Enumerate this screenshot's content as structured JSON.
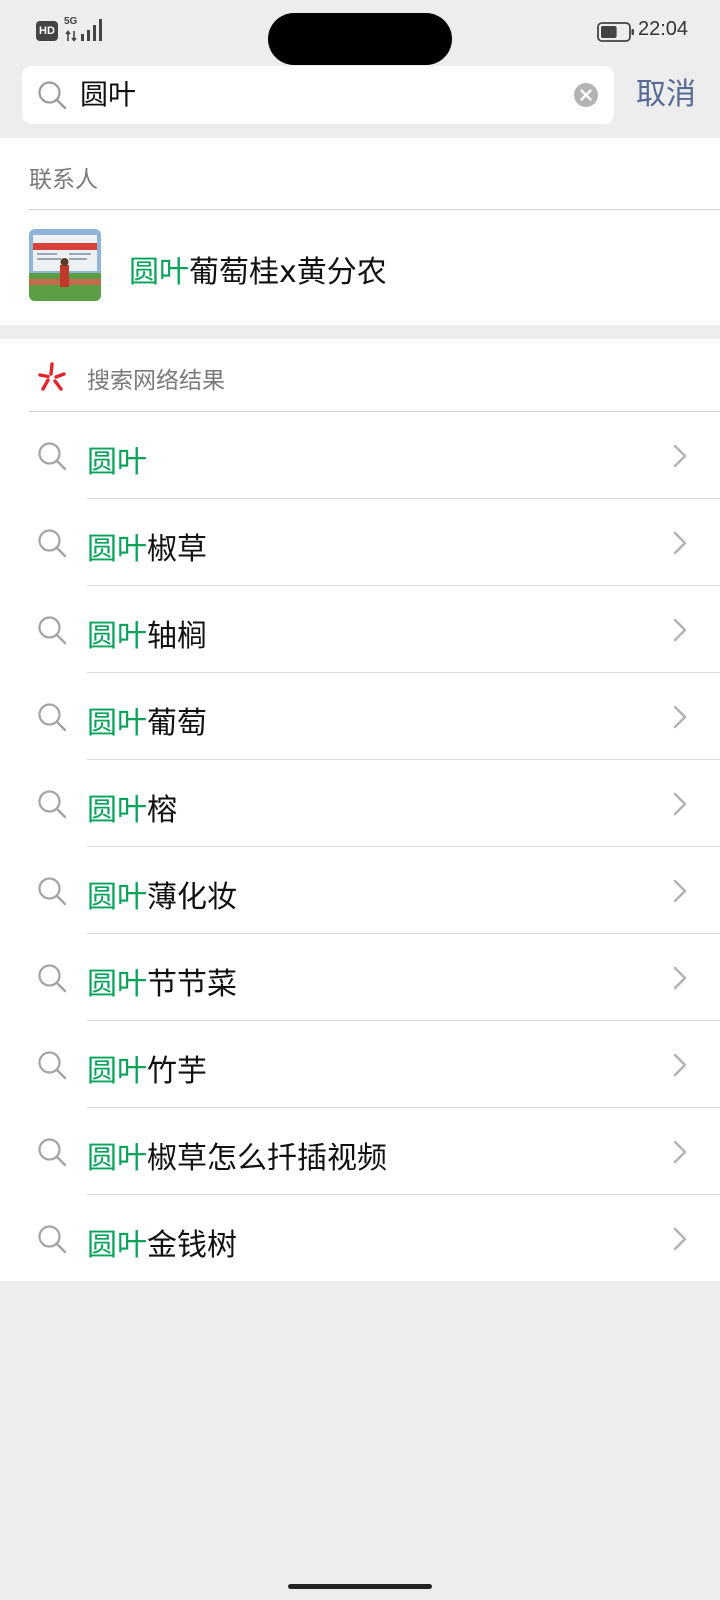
{
  "status_bar": {
    "hd_label": "HD",
    "network_label": "5G",
    "time": "22:04",
    "battery_level": 0.6
  },
  "search": {
    "query": "圆叶",
    "cancel_label": "取消"
  },
  "contacts": {
    "section_title": "联系人",
    "items": [
      {
        "highlight": "圆叶",
        "rest": "葡萄桂x黄分农"
      }
    ]
  },
  "web_results": {
    "section_title": "搜索网络结果",
    "items": [
      {
        "highlight": "圆叶",
        "rest": ""
      },
      {
        "highlight": "圆叶",
        "rest": "椒草"
      },
      {
        "highlight": "圆叶",
        "rest": "轴榈"
      },
      {
        "highlight": "圆叶",
        "rest": "葡萄"
      },
      {
        "highlight": "圆叶",
        "rest": "榕"
      },
      {
        "highlight": "圆叶",
        "rest": "薄化妆"
      },
      {
        "highlight": "圆叶",
        "rest": "节节菜"
      },
      {
        "highlight": "圆叶",
        "rest": "竹芋"
      },
      {
        "highlight": "圆叶",
        "rest": "椒草怎么扦插视频"
      },
      {
        "highlight": "圆叶",
        "rest": "金钱树"
      }
    ]
  },
  "colors": {
    "highlight": "#07a35a",
    "cancel": "#576b95",
    "background": "#ededed"
  },
  "icons": {
    "search": "search-icon",
    "clear": "clear-icon",
    "chevron": "chevron-right-icon",
    "web_logo": "wechat-search-logo"
  }
}
